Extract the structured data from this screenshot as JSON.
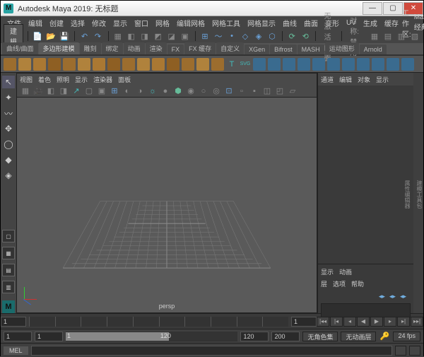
{
  "title": "Autodesk Maya 2019: 无标题",
  "menus": [
    "文件",
    "编辑",
    "创建",
    "选择",
    "修改",
    "显示",
    "窗口",
    "网格",
    "编辑网格",
    "网格工具",
    "网格显示",
    "曲线",
    "曲面",
    "变形",
    "UV",
    "生成",
    "缓存"
  ],
  "workspace_label": "工作区:",
  "workspace_value": "Maya 经典",
  "mode_dropdown": "建模",
  "status_label_1": "无激活曲面",
  "status_label_2": "对称: 禁用",
  "shelf_tabs": [
    "曲线/曲面",
    "多边形建模",
    "雕刻",
    "绑定",
    "动画",
    "渲染",
    "FX",
    "FX 缓存",
    "自定义",
    "XGen",
    "Bifrost",
    "MASH",
    "运动图形",
    "Arnold"
  ],
  "shelf_active_index": 1,
  "panel_menus": [
    "视图",
    "着色",
    "照明",
    "显示",
    "渲染器",
    "面板"
  ],
  "camera_label": "persp",
  "channelbox_tabs": [
    "通道",
    "编辑",
    "对象",
    "显示"
  ],
  "anim_layers": {
    "tabs": [
      "显示",
      "动画"
    ],
    "row2": [
      "层",
      "选项",
      "帮助"
    ]
  },
  "time": {
    "start": "1",
    "end": "200",
    "range_start": "1",
    "range_end": "120",
    "current": "1"
  },
  "color_mgmt": "无角色集",
  "anim_layer_dd": "无动画层",
  "fps": "24 fps",
  "cmd_label": "MEL",
  "sidetabs": [
    "建模工具包",
    "属性编辑器",
    "工具设置"
  ]
}
